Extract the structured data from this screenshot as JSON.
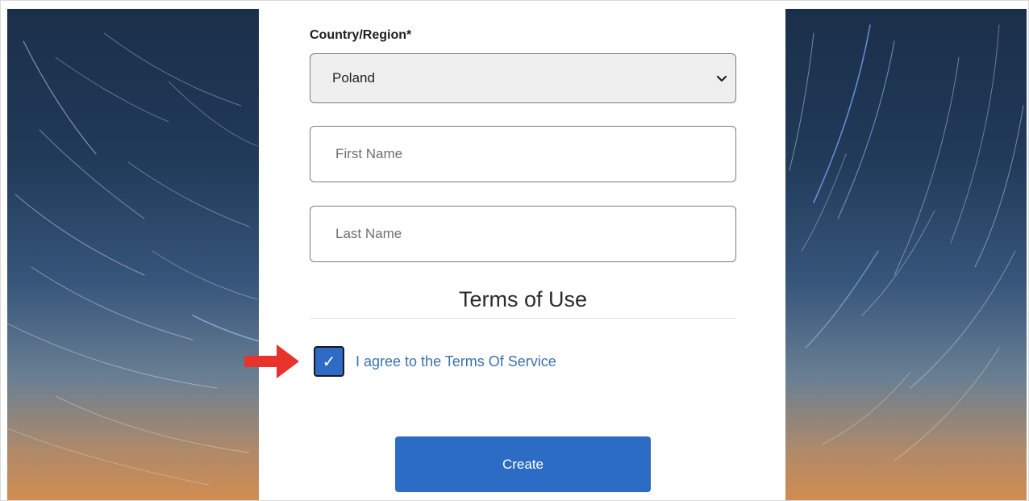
{
  "form": {
    "country_label": "Country/Region*",
    "country_selected": "Poland",
    "first_name_placeholder": "First Name",
    "last_name_placeholder": "Last Name",
    "terms_heading": "Terms of Use",
    "terms_checked": true,
    "terms_check_glyph": "✓",
    "terms_agree_label": "I agree to the Terms Of Service",
    "create_label": "Create"
  },
  "icons": {
    "select_chevron": "chevron-down-icon",
    "checkbox_check": "checkmark-icon",
    "annotation_arrow": "arrow-right-icon"
  },
  "colors": {
    "button_bg": "#2d6cc4",
    "checkbox_bg": "#2f6bc4",
    "link_text": "#3a73a8",
    "annotation_arrow": "#e8332d"
  }
}
